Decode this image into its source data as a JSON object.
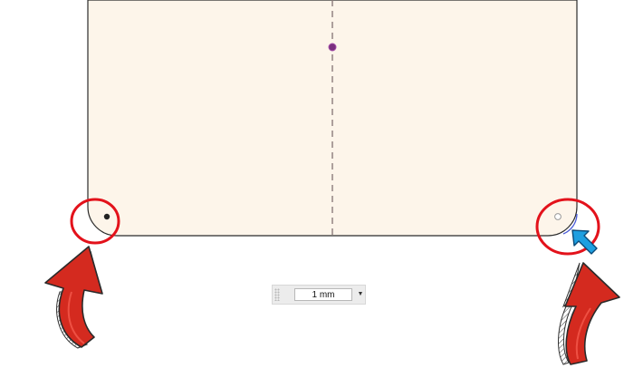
{
  "sketch": {
    "profile_fill": "#fdf5ea",
    "profile_stroke": "#2b2b2b",
    "centerline_color": "#8b7b7b",
    "midpoint_color": "#7a2f7e",
    "highlight_ring_color": "#e3121b",
    "annotation_arrow_color": "#d42a1f",
    "cursor_color": "#1e9fe0"
  },
  "dimension_input": {
    "value": "1 mm",
    "dropdown_icon": "triangle-down-icon"
  }
}
